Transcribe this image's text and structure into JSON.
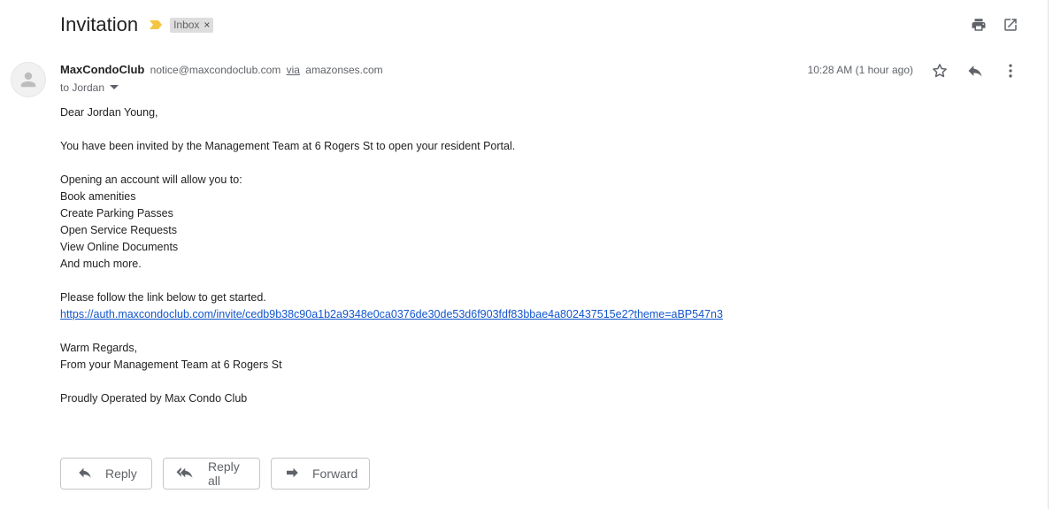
{
  "subject": "Invitation",
  "label": "Inbox",
  "label_remove": "×",
  "sender": {
    "name": "MaxCondoClub",
    "email": "notice@maxcondoclub.com",
    "via": "via",
    "via_domain": "amazonses.com"
  },
  "to_line": "to Jordan",
  "timestamp": "10:28 AM (1 hour ago)",
  "body": {
    "greeting": "Dear Jordan Young,",
    "invite": "You have been invited by the Management Team at 6 Rogers St to open your resident Portal.",
    "allow_intro": "Opening an account will allow you to:",
    "features": [
      "Book amenities",
      "Create Parking Passes",
      "Open Service Requests",
      "View Online Documents",
      "And much more."
    ],
    "follow": "Please follow the link below to get started.",
    "link": "https://auth.maxcondoclub.com/invite/cedb9b38c90a1b2a9348e0ca0376de30de53d6f903fdf83bbae4a802437515e2?theme=aBP547n3",
    "regards": "Warm Regards,",
    "from_team": "From your Management Team at 6 Rogers St",
    "operated": "Proudly Operated by Max Condo Club"
  },
  "buttons": {
    "reply": "Reply",
    "reply_all": "Reply all",
    "forward": "Forward"
  },
  "icons": {
    "importance": "importance-marker-icon",
    "print": "print-icon",
    "open_new_window": "open-in-new-window-icon",
    "star": "star-icon",
    "reply": "reply-icon",
    "more": "more-vert-icon",
    "avatar": "person-icon",
    "caret": "caret-down-icon",
    "reply_all": "reply-all-icon",
    "forward": "forward-icon"
  },
  "colors": {
    "importance": "#f4c542",
    "link": "#1155cc",
    "label_bg": "#dddddd"
  }
}
